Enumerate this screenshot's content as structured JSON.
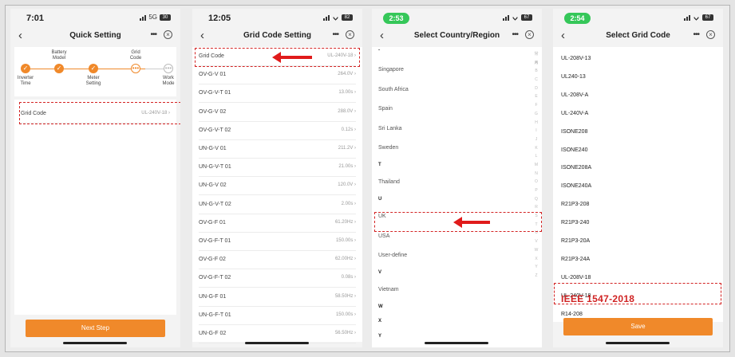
{
  "screens": [
    {
      "time": "7:01",
      "network": "5G",
      "battery": "30",
      "title": "Quick Setting",
      "steps": [
        {
          "label": "Inverter\nTime",
          "state": "done"
        },
        {
          "label": "Battery\nModel",
          "state": "done"
        },
        {
          "label": "Meter\nSetting",
          "state": "done"
        },
        {
          "label": "Grid\nCode",
          "state": "current"
        },
        {
          "label": "Work\nMode",
          "state": "pending"
        }
      ],
      "row": {
        "label": "Grid Code",
        "value": "UL-240V-18"
      },
      "button": "Next Step"
    },
    {
      "time": "12:05",
      "battery": "82",
      "title": "Grid Code Setting",
      "rows": [
        {
          "label": "Grid Code",
          "value": "UL-240V-18"
        },
        {
          "label": "OV-G-V 01",
          "value": "264.0V"
        },
        {
          "label": "OV-G-V-T 01",
          "value": "13.00s"
        },
        {
          "label": "OV-G-V 02",
          "value": "288.0V"
        },
        {
          "label": "OV-G-V-T 02",
          "value": "0.12s"
        },
        {
          "label": "UN-G-V 01",
          "value": "211.2V"
        },
        {
          "label": "UN-G-V-T 01",
          "value": "21.00s"
        },
        {
          "label": "UN-G-V 02",
          "value": "120.0V"
        },
        {
          "label": "UN-G-V-T 02",
          "value": "2.00s"
        },
        {
          "label": "OV-G-F 01",
          "value": "61.20Hz"
        },
        {
          "label": "OV-G-F-T 01",
          "value": "150.00s"
        },
        {
          "label": "OV-G-F 02",
          "value": "62.00Hz"
        },
        {
          "label": "OV-G-F-T 02",
          "value": "0.08s"
        },
        {
          "label": "UN-G-F 01",
          "value": "58.50Hz"
        },
        {
          "label": "UN-G-F-T 01",
          "value": "150.00s"
        },
        {
          "label": "UN-G-F 02",
          "value": "56.50Hz"
        }
      ]
    },
    {
      "time": "2:53",
      "battery": "67",
      "title": "Select Country/Region",
      "items": [
        {
          "type": "item",
          "text": "Singapore"
        },
        {
          "type": "item",
          "text": "South Africa"
        },
        {
          "type": "item",
          "text": "Spain"
        },
        {
          "type": "item",
          "text": "Sri Lanka"
        },
        {
          "type": "item",
          "text": "Sweden"
        },
        {
          "type": "head",
          "text": "T"
        },
        {
          "type": "item",
          "text": "Thailand"
        },
        {
          "type": "head",
          "text": "U"
        },
        {
          "type": "item",
          "text": "UK"
        },
        {
          "type": "item",
          "text": "USA"
        },
        {
          "type": "item",
          "text": "User-define"
        },
        {
          "type": "head",
          "text": "V"
        },
        {
          "type": "item",
          "text": "Vietnam"
        },
        {
          "type": "head",
          "text": "W"
        },
        {
          "type": "head",
          "text": "X"
        },
        {
          "type": "head",
          "text": "Y"
        },
        {
          "type": "head",
          "text": "Z"
        }
      ],
      "index": [
        "常用",
        "A",
        "B",
        "C",
        "D",
        "E",
        "F",
        "G",
        "H",
        "I",
        "J",
        "K",
        "L",
        "M",
        "N",
        "O",
        "P",
        "Q",
        "R",
        "S",
        "T",
        "U",
        "V",
        "W",
        "X",
        "Y",
        "Z"
      ]
    },
    {
      "time": "2:54",
      "battery": "67",
      "title": "Select Grid Code",
      "codes": [
        "UL-208V-13",
        "UL240-13",
        "UL-208V-A",
        "UL-240V-A",
        "ISONE208",
        "ISONE240",
        "ISONE208A",
        "ISONE240A",
        "R21P3-208",
        "R21P3-240",
        "R21P3-20A",
        "R21P3-24A",
        "UL-208V-18",
        "UL-240V-18",
        "R14-208"
      ],
      "annotation": "IEEE 1547-2018",
      "button": "Save"
    }
  ],
  "colors": {
    "accent": "#f0892a",
    "highlight": "#d32424",
    "status_pill": "#35c759"
  }
}
